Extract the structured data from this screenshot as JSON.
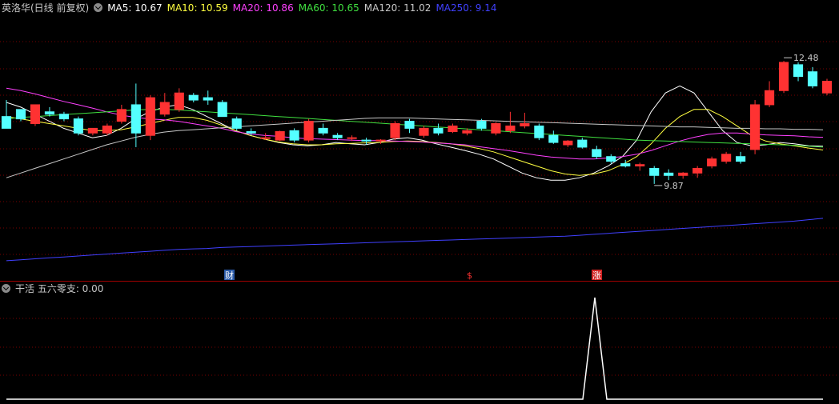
{
  "main_legend": {
    "title": "英洛华(日线 前复权)",
    "items": [
      {
        "label": "MA5: 10.67",
        "color": "#ffffff"
      },
      {
        "label": "MA10: 10.59",
        "color": "#ffff40"
      },
      {
        "label": "MA20: 10.86",
        "color": "#ff40ff"
      },
      {
        "label": "MA60: 10.65",
        "color": "#40e040"
      },
      {
        "label": "MA120: 11.02",
        "color": "#c8c8c8"
      },
      {
        "label": "MA250: 9.14",
        "color": "#4040ff"
      }
    ]
  },
  "sub_legend": {
    "title": "干活 五六零支: 0.00"
  },
  "markers": {
    "cai": "财",
    "dollar": "$",
    "zhang": "涨"
  },
  "colors": {
    "up": "#ff3232",
    "down": "#54ffff",
    "grid": "#7a0000",
    "ma250": "#4040ff"
  },
  "chart_data": [
    {
      "type": "candlestick",
      "title": "英洛华(日线 前复权)",
      "annotations": [
        {
          "label": "12.48",
          "type": "high"
        },
        {
          "label": "9.87",
          "type": "low"
        }
      ],
      "ylim": [
        8.0,
        13.4
      ],
      "series": [
        {
          "name": "MA5",
          "values": [
            11.6,
            11.5,
            11.35,
            11.2,
            11.05,
            10.95,
            10.85,
            10.9,
            11.05,
            11.25,
            11.4,
            11.5,
            11.55,
            11.45,
            11.3,
            11.15,
            11.0,
            10.9,
            10.82,
            10.75,
            10.7,
            10.68,
            10.7,
            10.75,
            10.72,
            10.7,
            10.75,
            10.82,
            10.85,
            10.8,
            10.72,
            10.65,
            10.58,
            10.5,
            10.4,
            10.25,
            10.1,
            10.0,
            9.95,
            9.95,
            10.0,
            10.1,
            10.25,
            10.45,
            10.8,
            11.4,
            11.8,
            11.95,
            11.8,
            11.4,
            11.0,
            10.75,
            10.68,
            10.7,
            10.75,
            10.72,
            10.68,
            10.67
          ]
        },
        {
          "name": "MA10",
          "values": [
            11.3,
            11.25,
            11.2,
            11.15,
            11.1,
            11.05,
            11.0,
            11.0,
            11.02,
            11.08,
            11.15,
            11.22,
            11.28,
            11.28,
            11.22,
            11.12,
            11.0,
            10.9,
            10.82,
            10.76,
            10.72,
            10.7,
            10.7,
            10.72,
            10.73,
            10.74,
            10.75,
            10.77,
            10.78,
            10.77,
            10.75,
            10.72,
            10.68,
            10.62,
            10.55,
            10.45,
            10.35,
            10.25,
            10.15,
            10.08,
            10.05,
            10.08,
            10.15,
            10.28,
            10.45,
            10.72,
            11.05,
            11.3,
            11.45,
            11.45,
            11.3,
            11.1,
            10.9,
            10.78,
            10.72,
            10.68,
            10.63,
            10.59
          ]
        },
        {
          "name": "MA20",
          "values": [
            11.9,
            11.85,
            11.78,
            11.7,
            11.62,
            11.55,
            11.48,
            11.4,
            11.33,
            11.28,
            11.25,
            11.23,
            11.2,
            11.15,
            11.1,
            11.05,
            10.98,
            10.93,
            10.9,
            10.88,
            10.85,
            10.83,
            10.82,
            10.81,
            10.8,
            10.79,
            10.79,
            10.78,
            10.77,
            10.76,
            10.74,
            10.72,
            10.7,
            10.66,
            10.62,
            10.58,
            10.53,
            10.48,
            10.44,
            10.42,
            10.4,
            10.4,
            10.42,
            10.45,
            10.5,
            10.58,
            10.68,
            10.78,
            10.86,
            10.92,
            10.95,
            10.95,
            10.93,
            10.91,
            10.9,
            10.89,
            10.87,
            10.86
          ]
        },
        {
          "name": "MA60",
          "values": [
            11.25,
            11.28,
            11.3,
            11.32,
            11.34,
            11.36,
            11.38,
            11.4,
            11.42,
            11.44,
            11.45,
            11.45,
            11.44,
            11.42,
            11.4,
            11.38,
            11.36,
            11.34,
            11.32,
            11.3,
            11.28,
            11.26,
            11.24,
            11.22,
            11.2,
            11.18,
            11.16,
            11.14,
            11.12,
            11.1,
            11.08,
            11.06,
            11.04,
            11.02,
            11.0,
            10.98,
            10.96,
            10.94,
            10.92,
            10.9,
            10.88,
            10.86,
            10.84,
            10.82,
            10.8,
            10.79,
            10.78,
            10.77,
            10.76,
            10.75,
            10.74,
            10.73,
            10.72,
            10.71,
            10.7,
            10.69,
            10.67,
            10.65
          ]
        },
        {
          "name": "MA120",
          "values": [
            10.0,
            10.1,
            10.2,
            10.3,
            10.4,
            10.5,
            10.6,
            10.7,
            10.78,
            10.86,
            10.92,
            10.97,
            11.0,
            11.02,
            11.04,
            11.06,
            11.08,
            11.1,
            11.12,
            11.14,
            11.16,
            11.18,
            11.2,
            11.22,
            11.24,
            11.26,
            11.27,
            11.27,
            11.27,
            11.26,
            11.25,
            11.24,
            11.23,
            11.22,
            11.21,
            11.2,
            11.19,
            11.18,
            11.17,
            11.16,
            11.15,
            11.14,
            11.13,
            11.12,
            11.11,
            11.1,
            11.09,
            11.08,
            11.08,
            11.07,
            11.06,
            11.05,
            11.05,
            11.04,
            11.04,
            11.03,
            11.03,
            11.02
          ]
        },
        {
          "name": "MA250",
          "values": [
            8.24,
            8.26,
            8.28,
            8.3,
            8.32,
            8.34,
            8.36,
            8.38,
            8.4,
            8.42,
            8.44,
            8.46,
            8.48,
            8.49,
            8.5,
            8.52,
            8.53,
            8.54,
            8.55,
            8.56,
            8.57,
            8.58,
            8.59,
            8.6,
            8.61,
            8.62,
            8.63,
            8.64,
            8.65,
            8.66,
            8.67,
            8.68,
            8.69,
            8.7,
            8.71,
            8.72,
            8.73,
            8.74,
            8.75,
            8.76,
            8.78,
            8.8,
            8.82,
            8.84,
            8.86,
            8.88,
            8.9,
            8.92,
            8.94,
            8.96,
            8.98,
            9.0,
            9.02,
            9.04,
            9.06,
            9.08,
            9.11,
            9.14
          ]
        }
      ],
      "ohlc": [
        [
          11.3,
          11.65,
          11.05,
          11.05
        ],
        [
          11.45,
          11.45,
          11.2,
          11.25
        ],
        [
          11.15,
          11.55,
          11.1,
          11.55
        ],
        [
          11.4,
          11.5,
          11.3,
          11.35
        ],
        [
          11.35,
          11.4,
          11.2,
          11.25
        ],
        [
          11.25,
          11.3,
          10.9,
          10.95
        ],
        [
          10.95,
          11.05,
          10.9,
          11.05
        ],
        [
          10.95,
          11.15,
          10.9,
          11.1
        ],
        [
          11.2,
          11.55,
          11.15,
          11.45
        ],
        [
          11.55,
          12.0,
          10.65,
          10.95
        ],
        [
          10.9,
          11.75,
          10.8,
          11.7
        ],
        [
          11.35,
          11.8,
          11.3,
          11.6
        ],
        [
          11.45,
          11.9,
          11.4,
          11.8
        ],
        [
          11.75,
          11.8,
          11.6,
          11.65
        ],
        [
          11.7,
          11.85,
          11.55,
          11.65
        ],
        [
          11.6,
          11.65,
          11.3,
          11.3
        ],
        [
          11.25,
          11.3,
          11.0,
          11.05
        ],
        [
          10.98,
          11.05,
          10.9,
          10.95
        ],
        [
          10.85,
          10.95,
          10.8,
          10.85
        ],
        [
          10.8,
          11.0,
          10.78,
          10.98
        ],
        [
          11.0,
          11.05,
          10.75,
          10.8
        ],
        [
          10.8,
          11.25,
          10.75,
          11.2
        ],
        [
          11.05,
          11.15,
          10.9,
          10.95
        ],
        [
          10.9,
          10.95,
          10.8,
          10.85
        ],
        [
          10.85,
          10.9,
          10.78,
          10.85
        ],
        [
          10.8,
          10.85,
          10.7,
          10.78
        ],
        [
          10.78,
          10.82,
          10.72,
          10.8
        ],
        [
          10.85,
          11.2,
          10.8,
          11.15
        ],
        [
          11.2,
          11.25,
          10.95,
          11.05
        ],
        [
          10.9,
          11.1,
          10.85,
          11.05
        ],
        [
          11.05,
          11.15,
          10.9,
          10.95
        ],
        [
          10.98,
          11.15,
          10.95,
          11.1
        ],
        [
          10.95,
          11.05,
          10.9,
          11.0
        ],
        [
          11.2,
          11.25,
          11.0,
          11.05
        ],
        [
          10.95,
          11.18,
          10.9,
          11.15
        ],
        [
          11.0,
          11.4,
          10.95,
          11.1
        ],
        [
          11.1,
          11.38,
          11.05,
          11.15
        ],
        [
          11.1,
          11.15,
          10.8,
          10.85
        ],
        [
          10.9,
          11.0,
          10.72,
          10.75
        ],
        [
          10.7,
          10.8,
          10.65,
          10.78
        ],
        [
          10.8,
          10.85,
          10.62,
          10.65
        ],
        [
          10.6,
          10.68,
          10.4,
          10.45
        ],
        [
          10.45,
          10.5,
          10.3,
          10.35
        ],
        [
          10.3,
          10.38,
          10.22,
          10.25
        ],
        [
          10.25,
          10.32,
          10.15,
          10.28
        ],
        [
          10.2,
          10.25,
          9.87,
          10.05
        ],
        [
          10.1,
          10.18,
          9.95,
          10.05
        ],
        [
          10.05,
          10.12,
          9.98,
          10.1
        ],
        [
          10.1,
          10.25,
          10.0,
          10.2
        ],
        [
          10.25,
          10.45,
          10.2,
          10.4
        ],
        [
          10.35,
          10.55,
          10.3,
          10.5
        ],
        [
          10.45,
          10.55,
          10.3,
          10.35
        ],
        [
          10.6,
          11.65,
          10.5,
          11.55
        ],
        [
          11.55,
          12.05,
          11.5,
          11.85
        ],
        [
          11.85,
          12.48,
          11.8,
          12.45
        ],
        [
          12.4,
          12.45,
          12.05,
          12.15
        ],
        [
          12.25,
          12.35,
          11.9,
          11.95
        ],
        [
          11.8,
          12.1,
          11.75,
          12.05
        ]
      ]
    },
    {
      "type": "line",
      "title": "干活 五六零支: 0.00",
      "ylim": [
        0,
        1
      ],
      "x": [
        0,
        1,
        2,
        3,
        4,
        5,
        6,
        7,
        8,
        9,
        10,
        11,
        12,
        13,
        14,
        15,
        16,
        17,
        18,
        19,
        20,
        21,
        22,
        23,
        24,
        25,
        26,
        27,
        28,
        29,
        30,
        31,
        32,
        33,
        34,
        35,
        36,
        37,
        38,
        39,
        40,
        41,
        42,
        43,
        44,
        45,
        46,
        47,
        48,
        49,
        50,
        51,
        52,
        53,
        54,
        55,
        56,
        57,
        58,
        59,
        60,
        61,
        62,
        63,
        64,
        65,
        66,
        67,
        68
      ],
      "series": [
        {
          "name": "五六零支",
          "values": [
            0,
            0,
            0,
            0,
            0,
            0,
            0,
            0,
            0,
            0,
            0,
            0,
            0,
            0,
            0,
            0,
            0,
            0,
            0,
            0,
            0,
            0,
            0,
            0,
            0,
            0,
            0,
            0,
            0,
            0,
            0,
            0,
            0,
            0,
            0,
            0,
            0,
            0,
            0,
            0,
            0,
            0,
            0,
            0,
            0,
            0,
            0,
            0,
            0,
            1,
            0,
            0,
            0,
            0,
            0,
            0,
            0,
            0,
            0,
            0,
            0,
            0,
            0,
            0,
            0,
            0,
            0,
            0,
            0
          ]
        }
      ]
    }
  ]
}
